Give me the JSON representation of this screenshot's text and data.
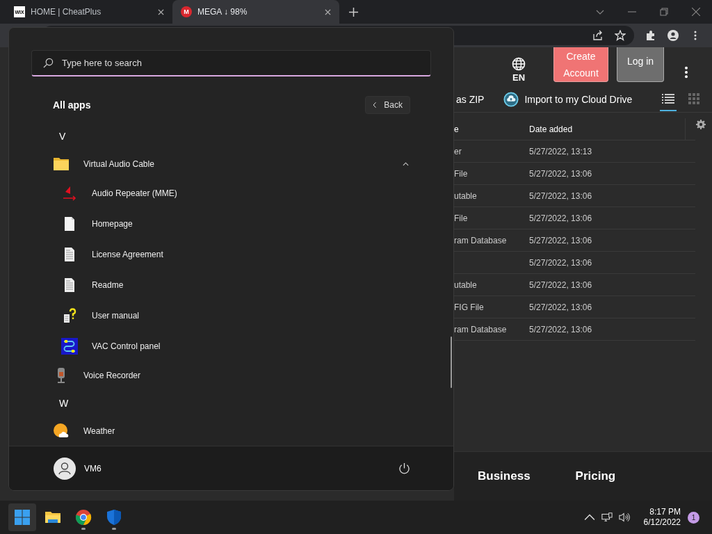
{
  "browser": {
    "tabs": [
      {
        "favicon": "WIX",
        "title": "HOME | CheatPlus",
        "selected": false
      },
      {
        "favicon": "M",
        "title": "MEGA ↓ 98%",
        "selected": true
      }
    ]
  },
  "page": {
    "language": "EN",
    "buttons": [
      {
        "label": "Create Account",
        "kind": "primary"
      },
      {
        "label": "Log in",
        "kind": "secondary"
      }
    ],
    "download_label": "as ZIP",
    "import_label": "Import to my Cloud Drive",
    "view_modes": [
      {
        "kind": "list",
        "selected": true
      },
      {
        "kind": "grid",
        "selected": false
      }
    ],
    "table": {
      "columns": [
        "e",
        "Date added"
      ],
      "rows": [
        {
          "column_1": "er",
          "date_added": "5/27/2022, 13:13"
        },
        {
          "column_1": "File",
          "date_added": "5/27/2022, 13:06"
        },
        {
          "column_1": "utable",
          "date_added": "5/27/2022, 13:06"
        },
        {
          "column_1": "File",
          "date_added": "5/27/2022, 13:06"
        },
        {
          "column_1": "ram Database",
          "date_added": "5/27/2022, 13:06"
        },
        {
          "date_added": "5/27/2022, 13:06"
        },
        {
          "column_1": "utable",
          "date_added": "5/27/2022, 13:06"
        },
        {
          "column_1": "FIG File",
          "date_added": "5/27/2022, 13:06"
        },
        {
          "column_1": "ram Database",
          "date_added": "5/27/2022, 13:06"
        }
      ]
    },
    "footer_links": [
      "Business",
      "Pricing"
    ]
  },
  "start_menu": {
    "search": {
      "placeholder": "Type here to search"
    },
    "heading": "All apps",
    "back_button": "Back",
    "items": [
      {
        "kind": "letter",
        "label": "V"
      },
      {
        "kind": "folder",
        "label": "Virtual Audio Cable",
        "expanded": true,
        "children": [
          {
            "kind": "app",
            "label": "Audio Repeater (MME)"
          },
          {
            "kind": "app",
            "label": "Homepage"
          },
          {
            "kind": "app",
            "label": "License Agreement"
          },
          {
            "kind": "app",
            "label": "Readme"
          },
          {
            "kind": "app",
            "label": "User manual"
          },
          {
            "kind": "app",
            "label": "VAC Control panel"
          }
        ]
      },
      {
        "kind": "app",
        "label": "Voice Recorder"
      },
      {
        "kind": "letter",
        "label": "W"
      },
      {
        "kind": "app",
        "label": "Weather"
      }
    ],
    "user": {
      "name": "VM6"
    }
  },
  "taskbar": {
    "apps": [
      {
        "kind": "start",
        "active": true,
        "running": false
      },
      {
        "kind": "files",
        "active": false,
        "running": false
      },
      {
        "kind": "browser",
        "active": false,
        "running": true
      },
      {
        "kind": "shield",
        "active": false,
        "running": true
      }
    ],
    "time": "8:17 PM",
    "date": "6/12/2022",
    "notifications": "1"
  }
}
